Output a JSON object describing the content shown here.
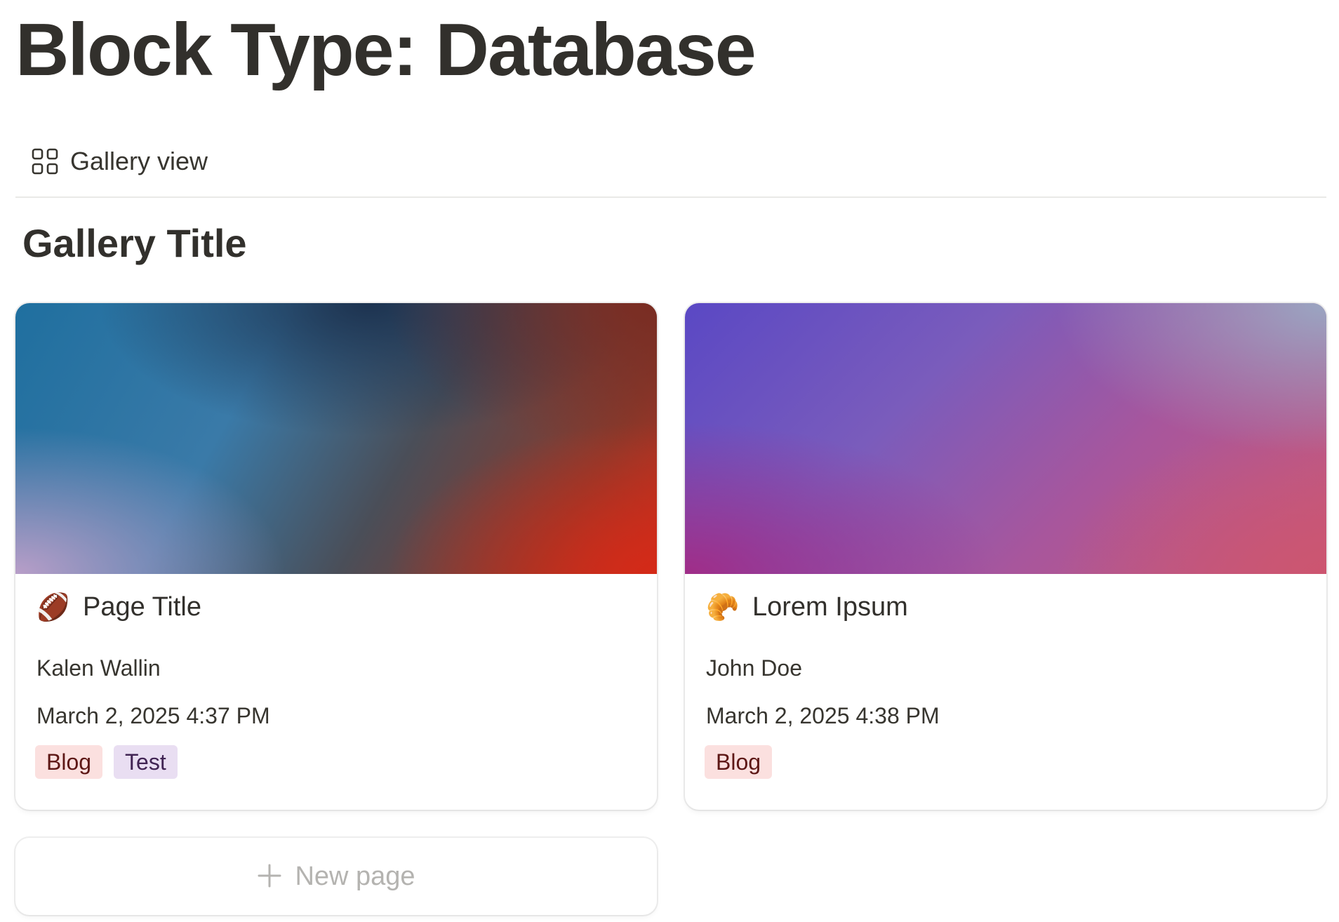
{
  "page": {
    "title": "Block Type: Database"
  },
  "view_bar": {
    "tab_label": "Gallery view",
    "tab_icon": "grid-icon"
  },
  "gallery": {
    "title": "Gallery Title",
    "cards": [
      {
        "emoji": "🏈",
        "emoji_icon": "football-icon",
        "title": "Page Title",
        "author": "Kalen Wallin",
        "date": "March 2, 2025 4:37 PM",
        "tags": [
          {
            "label": "Blog",
            "color": "#fbe0df"
          },
          {
            "label": "Test",
            "color": "#e9def2"
          }
        ]
      },
      {
        "emoji": "🥐",
        "emoji_icon": "croissant-icon",
        "title": "Lorem Ipsum",
        "author": "John Doe",
        "date": "March 2, 2025 4:38 PM",
        "tags": [
          {
            "label": "Blog",
            "color": "#fbe0df"
          }
        ]
      }
    ],
    "new_page_label": "New page",
    "new_page_icon": "plus-icon"
  },
  "colors": {
    "text": "#37352f",
    "muted": "#b4b3b0",
    "divider": "#e9e9e7"
  }
}
